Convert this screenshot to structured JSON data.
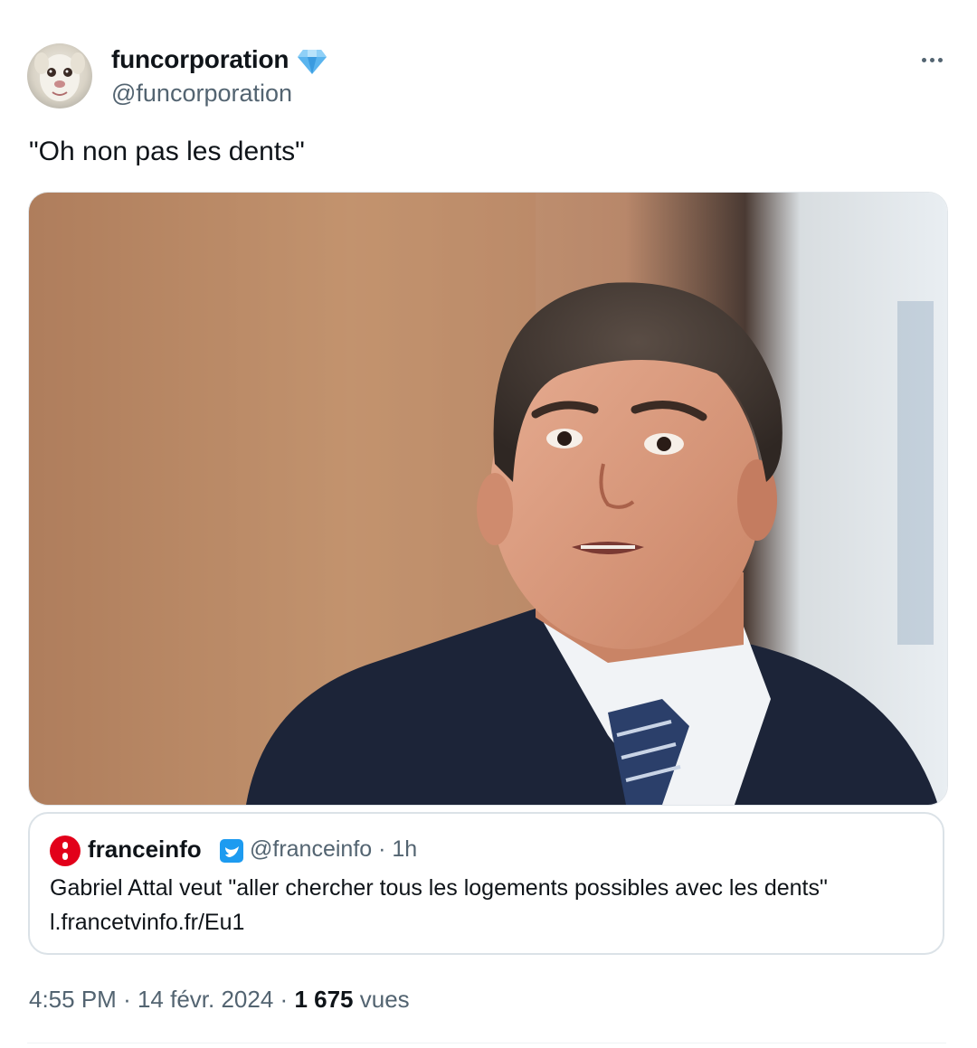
{
  "author": {
    "display_name": "funcorporation",
    "handle": "@funcorporation",
    "badge_icon": "diamond-icon",
    "badge_color": "#4aa8e8"
  },
  "tweet": {
    "text": "\"Oh non pas les dents\""
  },
  "quoted_tweet": {
    "display_name": "franceinfo",
    "handle": "@franceinfo",
    "time": "· 1h",
    "text": "Gabriel Attal veut \"aller chercher tous les logements possibles avec les dents\"",
    "link": "l.francetvinfo.fr/Eu1",
    "logo_color": "#e2001a",
    "verified_color": "#1d9bf0"
  },
  "footer": {
    "time": "4:55 PM",
    "separator": "·",
    "date": "14 févr. 2024",
    "views_count": "1 675",
    "views_label": "vues"
  },
  "colors": {
    "text_primary": "#0f1419",
    "text_secondary": "#536471",
    "border": "#dbe2e7"
  }
}
